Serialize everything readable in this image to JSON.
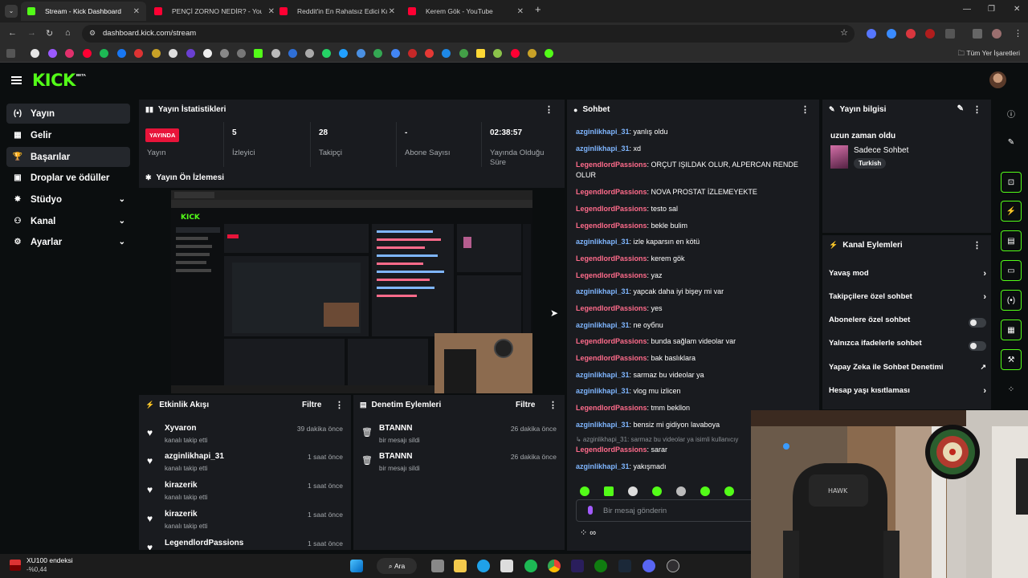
{
  "browser": {
    "tabs": [
      {
        "title": "Stream - Kick Dashboard",
        "active": true,
        "color": "#53fc18"
      },
      {
        "title": "PENÇİ ZORNO NEDİR? - YouTub",
        "active": false,
        "color": "#ff0033"
      },
      {
        "title": "Reddit'in En Rahatsız Edici Kullan",
        "active": false,
        "color": "#ff0033"
      },
      {
        "title": "Kerem Gök - YouTube",
        "active": false,
        "color": "#ff0033"
      }
    ],
    "url": "dashboard.kick.com/stream",
    "bookmarks_folder": "Tüm Yer İşaretleri"
  },
  "kick": {
    "logo": "KICK",
    "logo_beta": "BETA",
    "accent": "#53fc18"
  },
  "sidebar": {
    "items": [
      {
        "label": "Yayın",
        "icon": "broadcast-icon",
        "expandable": false,
        "selected": true
      },
      {
        "label": "Gelir",
        "icon": "revenue-icon",
        "expandable": false,
        "selected": false
      },
      {
        "label": "Başarılar",
        "icon": "trophy-icon",
        "expandable": false,
        "selected": true
      },
      {
        "label": "Droplar ve ödüller",
        "icon": "gift-icon",
        "expandable": false,
        "selected": false
      },
      {
        "label": "Stüdyo",
        "icon": "studio-icon",
        "expandable": true,
        "selected": false
      },
      {
        "label": "Kanal",
        "icon": "channel-icon",
        "expandable": true,
        "selected": false
      },
      {
        "label": "Ayarlar",
        "icon": "gear-icon",
        "expandable": true,
        "selected": false
      }
    ]
  },
  "stats": {
    "title": "Yayın İstatistikleri",
    "live_badge": "YAYINDA",
    "live_label": "Yayın",
    "cells": [
      {
        "value": "5",
        "label": "İzleyici"
      },
      {
        "value": "28",
        "label": "Takipçi"
      },
      {
        "value": "-",
        "label": "Abone Sayısı"
      },
      {
        "value": "02:38:57",
        "label": "Yayında Olduğu Süre"
      }
    ]
  },
  "preview": {
    "title": "Yayın Ön İzlemesi"
  },
  "activity": {
    "title": "Etkinlik Akışı",
    "filter": "Filtre",
    "items": [
      {
        "name": "Xyvaron",
        "sub": "kanalı takip etti",
        "time": "39 dakika önce"
      },
      {
        "name": "azginlikhapi_31",
        "sub": "kanalı takip etti",
        "time": "1 saat önce"
      },
      {
        "name": "kirazerik",
        "sub": "kanalı takip etti",
        "time": "1 saat önce"
      },
      {
        "name": "kirazerik",
        "sub": "kanalı takip etti",
        "time": "1 saat önce"
      },
      {
        "name": "LegendlordPassions",
        "sub": "",
        "time": "1 saat önce"
      }
    ]
  },
  "moderation": {
    "title": "Denetim Eylemleri",
    "filter": "Filtre",
    "items": [
      {
        "name": "BTANNN",
        "sub": "bir mesajı sildi",
        "time": "26 dakika önce"
      },
      {
        "name": "BTANNN",
        "sub": "bir mesajı sildi",
        "time": "26 dakika önce"
      }
    ]
  },
  "chat": {
    "title": "Sohbet",
    "messages": [
      {
        "user": "azginlikhapi_31",
        "text": ": yanlış oldu",
        "kind": 1
      },
      {
        "user": "azginlikhapi_31",
        "text": ": xd",
        "kind": 1
      },
      {
        "user": "LegendlordPassions",
        "text": ": ORÇUT IŞILDAK OLUR, ALPERCAN RENDE OLUR",
        "kind": 2
      },
      {
        "user": "LegendlordPassions",
        "text": ": NOVA PROSTAT İZLEMEYEKTE",
        "kind": 2
      },
      {
        "user": "LegendlordPassions",
        "text": ": testo sal",
        "kind": 2
      },
      {
        "user": "LegendlordPassions",
        "text": ": bekle bulim",
        "kind": 2
      },
      {
        "user": "azginlikhapi_31",
        "text": ": izle kaparsın en kötü",
        "kind": 1
      },
      {
        "user": "LegendlordPassions",
        "text": ": kerem gök",
        "kind": 2
      },
      {
        "user": "LegendlordPassions",
        "text": ": yaz",
        "kind": 2
      },
      {
        "user": "azginlikhapi_31",
        "text": ": yapcak daha iyi bişey mi var",
        "kind": 1
      },
      {
        "user": "LegendlordPassions",
        "text": ": yes",
        "kind": 2
      },
      {
        "user": "azginlikhapi_31",
        "text": ": ne oyбnu",
        "kind": 1
      },
      {
        "user": "LegendlordPassions",
        "text": ": bunda sağlam videolar var",
        "kind": 2
      },
      {
        "user": "LegendlordPassions",
        "text": ": bak baslıklara",
        "kind": 2
      },
      {
        "user": "azginlikhapi_31",
        "text": ": sarmaz bu videolar ya",
        "kind": 1
      },
      {
        "user": "azginlikhapi_31",
        "text": ": vlog mu izlicen",
        "kind": 1
      },
      {
        "user": "LegendlordPassions",
        "text": ": tmm bekllon",
        "kind": 2
      },
      {
        "user": "azginlikhapi_31",
        "text": ": bensiz mi gidiyon lavaboya",
        "kind": 1
      }
    ],
    "reply_preview": "↳ azginlikhapi_31: sarmaz bu videolar ya isimli kullanıcıy",
    "after_reply": [
      {
        "user": "LegendlordPassions",
        "text": ": sarar",
        "kind": 2
      },
      {
        "user": "azginlikhapi_31",
        "text": ": yakışmadı",
        "kind": 1
      }
    ],
    "input_placeholder": "Bir mesaj gönderin",
    "tools": "⁘ ∞"
  },
  "stream_info": {
    "title": "Yayın bilgisi",
    "stream_title": "uzun zaman oldu",
    "category": "Sadece Sohbet",
    "tag": "Turkish"
  },
  "channel_actions": {
    "title": "Kanal Eylemleri",
    "items": [
      {
        "label": "Yavaş mod",
        "control": "arrow"
      },
      {
        "label": "Takipçilere özel sohbet",
        "control": "arrow"
      },
      {
        "label": "Abonelere özel sohbet",
        "control": "toggle"
      },
      {
        "label": "Yalnızca ifadelerle sohbet",
        "control": "toggle"
      },
      {
        "label": "Yapay Zeka ile Sohbet Denetimi",
        "control": "external"
      },
      {
        "label": "Hesap yaşı kısıtlaması",
        "control": "arrow"
      }
    ]
  },
  "taskbar": {
    "ticker_name": "XU100 endeksi",
    "ticker_value": "-%0,44",
    "search_label": "Ara"
  }
}
